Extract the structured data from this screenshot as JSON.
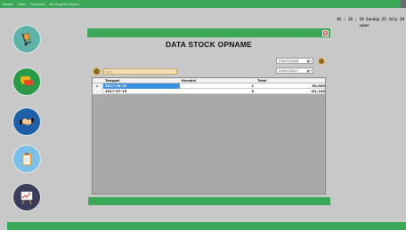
{
  "menubar": {
    "items": [
      "Master",
      "Data",
      "Transaksi",
      "All Graphic Report"
    ]
  },
  "clock": "02 : 18 : 18  Sunday 23 July 20",
  "user": "user",
  "header": {
    "close_label": "x"
  },
  "title": "DATA STOCK OPNAME",
  "filter": {
    "date_from": "23/07/2018",
    "date_to": "23/07/2017",
    "search_placeholder": "cari"
  },
  "table": {
    "columns": [
      "Tanggal",
      "Koreksi",
      "Total"
    ],
    "rows": [
      {
        "marker": "▸",
        "tanggal": "2017-08-15",
        "koreksi": "1",
        "total": "50,000"
      },
      {
        "marker": "",
        "tanggal": "2017-07-15",
        "koreksi": "3",
        "total": "-81,144"
      }
    ]
  },
  "colors": {
    "accent": "#3aa857",
    "background": "#c8c8c8",
    "selection": "#3b8fe0",
    "close": "#e04a3a"
  },
  "sidebar": {
    "icons": [
      "delivery-cart-icon",
      "chat-message-icon",
      "handshake-icon",
      "clipboard-icon",
      "chart-easel-icon"
    ]
  }
}
